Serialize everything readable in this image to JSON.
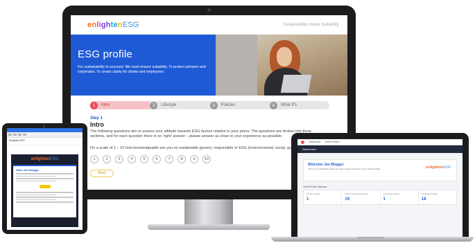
{
  "monitor": {
    "header": {
      "logo_main": "enlighten",
      "logo_suffix": "ESG",
      "tagline": "Sustainability meets Suitability"
    },
    "hero": {
      "title": "ESG profile",
      "subtitle": "For sustainability to succeed. We must ensure suitability. To protect advisers and corporates. To create clarity for clients and employees."
    },
    "steps": [
      {
        "num": "1",
        "label": "Intro"
      },
      {
        "num": "2",
        "label": "Lifestyle"
      },
      {
        "num": "3",
        "label": "Policies"
      },
      {
        "num": "4",
        "label": "What If's"
      }
    ],
    "step_label": "Step 1",
    "section_title": "Intro",
    "intro_text": "The following questions aim to assess your attitude towards ESG factors relative to your peers. The questions are broken into three sections, and for each question there is no 'right' answer – please answer as close to your experience as possible.",
    "question": "On a scale of 1 – 10 how knowledgeable are you on sustainable (green), responsible or ESG (environmental, social, governance) investing?",
    "scale": [
      "1",
      "2",
      "3",
      "4",
      "5",
      "6",
      "7",
      "8",
      "9",
      "10"
    ],
    "next_label": "Next"
  },
  "tablet": {
    "from_line": "Enlighten ESG",
    "greeting": "Hello Joe Bloggs",
    "logo_main": "enlighten",
    "logo_suffix": "ESG"
  },
  "laptop": {
    "nav": [
      "Dashboard",
      "Client Profiles"
    ],
    "bar_title": "Dashboard",
    "welcome_title": "Welcome Joe Bloggs!",
    "welcome_text": "This is your dashboard where you can review a summary of your client profiles.",
    "logo_main": "enlighten",
    "logo_suffix": "ESG",
    "status_title": "Client Profile Statuses",
    "stats": [
      {
        "label": "Clients Created",
        "value": "1"
      },
      {
        "label": "Clients Profiles Incomplete",
        "value": "19"
      },
      {
        "label": "Incomplete Profiles",
        "value": "1"
      },
      {
        "label": "Completed Profiles",
        "value": "18"
      }
    ]
  },
  "colors": {
    "brand_blue": "#1f5ad6",
    "step_active": "#ea4a5a",
    "next_border": "#f0c85a"
  }
}
